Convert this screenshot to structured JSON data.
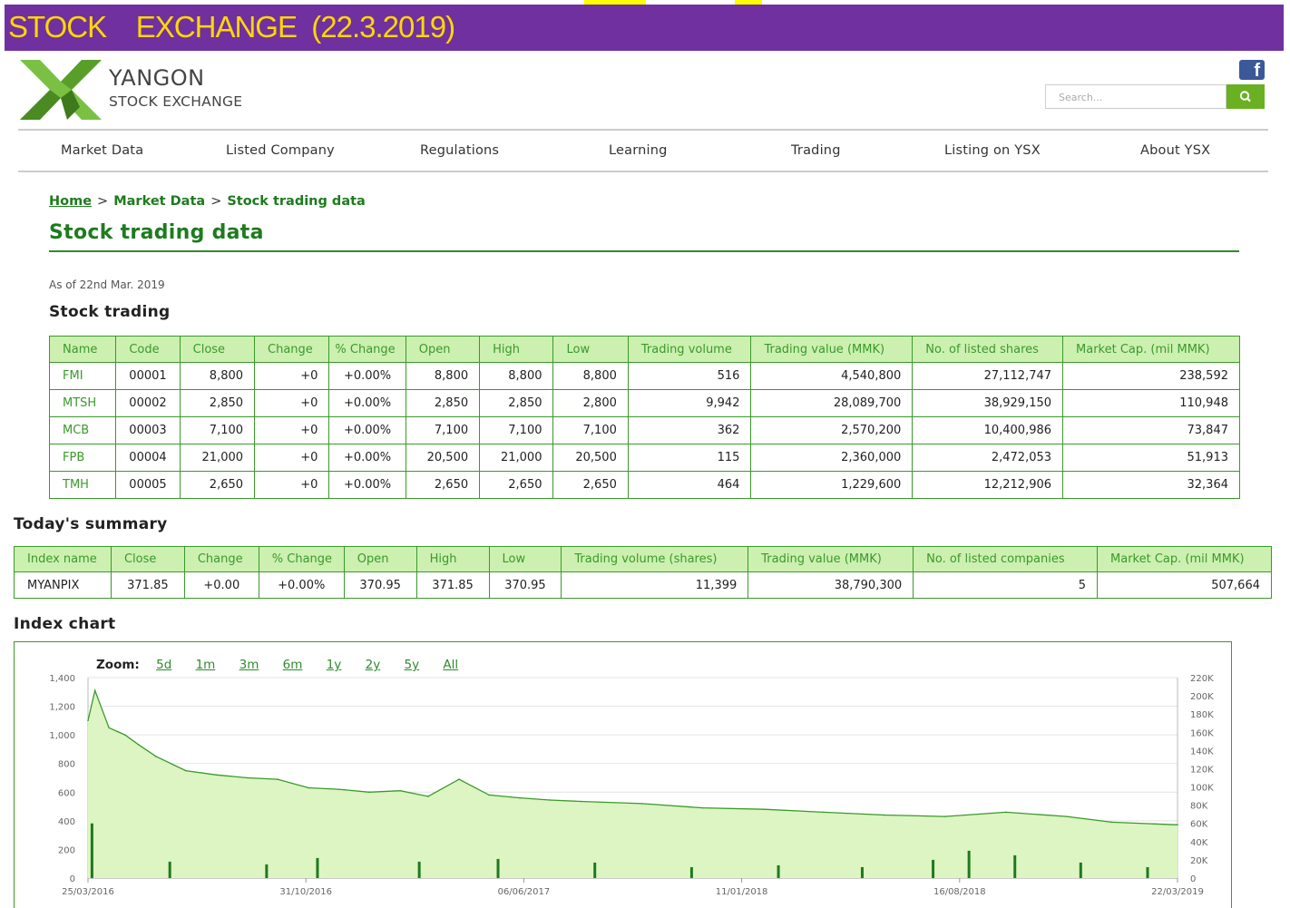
{
  "banner": {
    "title": "STOCK    EXCHANGE  (22.3.2019)",
    "bg_color": "#7030a0",
    "text_color": "#ffd700"
  },
  "header": {
    "logo_line1": "YANGON",
    "logo_line2": "STOCK EXCHANGE",
    "facebook_icon": "facebook-icon",
    "search_placeholder": "Search...",
    "search_icon": "search-icon",
    "accent": "#6ab023"
  },
  "nav": [
    "Market Data",
    "Listed Company",
    "Regulations",
    "Learning",
    "Trading",
    "Listing on YSX",
    "About YSX"
  ],
  "breadcrumb": {
    "home": "Home",
    "sep": ">",
    "market": "Market Data",
    "current": "Stock trading data"
  },
  "page_title": "Stock trading data",
  "as_of": "As of 22nd Mar. 2019",
  "stock_trading": {
    "heading": "Stock trading",
    "columns": [
      "Name",
      "Code",
      "Close",
      "Change",
      "% Change",
      "Open",
      "High",
      "Low",
      "Trading volume",
      "Trading value (MMK)",
      "No. of listed shares",
      "Market Cap. (mil MMK)"
    ],
    "rows": [
      [
        "FMI",
        "00001",
        "8,800",
        "+0",
        "+0.00%",
        "8,800",
        "8,800",
        "8,800",
        "516",
        "4,540,800",
        "27,112,747",
        "238,592"
      ],
      [
        "MTSH",
        "00002",
        "2,850",
        "+0",
        "+0.00%",
        "2,850",
        "2,850",
        "2,800",
        "9,942",
        "28,089,700",
        "38,929,150",
        "110,948"
      ],
      [
        "MCB",
        "00003",
        "7,100",
        "+0",
        "+0.00%",
        "7,100",
        "7,100",
        "7,100",
        "362",
        "2,570,200",
        "10,400,986",
        "73,847"
      ],
      [
        "FPB",
        "00004",
        "21,000",
        "+0",
        "+0.00%",
        "20,500",
        "21,000",
        "20,500",
        "115",
        "2,360,000",
        "2,472,053",
        "51,913"
      ],
      [
        "TMH",
        "00005",
        "2,650",
        "+0",
        "+0.00%",
        "2,650",
        "2,650",
        "2,650",
        "464",
        "1,229,600",
        "12,212,906",
        "32,364"
      ]
    ]
  },
  "summary": {
    "heading": "Today's summary",
    "columns": [
      "Index name",
      "Close",
      "Change",
      "% Change",
      "Open",
      "High",
      "Low",
      "Trading volume (shares)",
      "Trading value (MMK)",
      "No. of listed companies",
      "Market Cap. (mil MMK)"
    ],
    "row": [
      "MYANPIX",
      "371.85",
      "+0.00",
      "+0.00%",
      "370.95",
      "371.85",
      "370.95",
      "11,399",
      "38,790,300",
      "5",
      "507,664"
    ]
  },
  "index_chart": {
    "heading": "Index chart",
    "zoom_label": "Zoom:",
    "zoom_options": [
      "5d",
      "1m",
      "3m",
      "6m",
      "1y",
      "2y",
      "5y",
      "All"
    ]
  },
  "chart_data": {
    "type": "area",
    "x_tick_labels": [
      "25/03/2016",
      "31/10/2016",
      "06/06/2017",
      "11/01/2018",
      "16/08/2018",
      "22/03/2019"
    ],
    "y_left_ticks": [
      "0",
      "200",
      "400",
      "600",
      "800",
      "1,000",
      "1,200",
      "1,400"
    ],
    "y_right_ticks": [
      "0",
      "20K",
      "40K",
      "60K",
      "80K",
      "100K",
      "120K",
      "140K",
      "160K",
      "180K",
      "200K",
      "220K"
    ],
    "ylim_left": [
      0,
      1400
    ],
    "ylim_right": [
      0,
      220000
    ],
    "xlim": [
      "2016-03-25",
      "2019-03-22"
    ],
    "grid": true,
    "index_series": {
      "x": [
        "2016-03-25",
        "2016-04-01",
        "2016-04-15",
        "2016-05-01",
        "2016-05-15",
        "2016-06-01",
        "2016-07-01",
        "2016-08-01",
        "2016-09-01",
        "2016-10-01",
        "2016-11-01",
        "2016-12-01",
        "2017-01-01",
        "2017-02-01",
        "2017-03-01",
        "2017-04-01",
        "2017-05-01",
        "2017-06-01",
        "2017-07-01",
        "2017-08-01",
        "2017-10-01",
        "2017-12-01",
        "2018-02-01",
        "2018-04-01",
        "2018-06-01",
        "2018-08-01",
        "2018-10-01",
        "2018-12-01",
        "2019-01-15",
        "2019-03-22"
      ],
      "values": [
        1100,
        1310,
        1050,
        1000,
        930,
        850,
        750,
        720,
        700,
        690,
        630,
        620,
        600,
        610,
        570,
        690,
        580,
        560,
        545,
        535,
        520,
        490,
        480,
        460,
        440,
        430,
        460,
        430,
        390,
        372
      ]
    },
    "volume_series": {
      "x": [
        "2016-03-29",
        "2016-06-15",
        "2016-09-20",
        "2016-11-10",
        "2017-02-20",
        "2017-05-10",
        "2017-08-15",
        "2017-11-20",
        "2018-02-15",
        "2018-05-10",
        "2018-07-20",
        "2018-08-25",
        "2018-10-10",
        "2018-12-15",
        "2019-02-20"
      ],
      "values": [
        60000,
        18000,
        15000,
        22000,
        18000,
        21000,
        17000,
        12000,
        14000,
        12000,
        20000,
        30000,
        25000,
        17000,
        12000
      ]
    }
  }
}
